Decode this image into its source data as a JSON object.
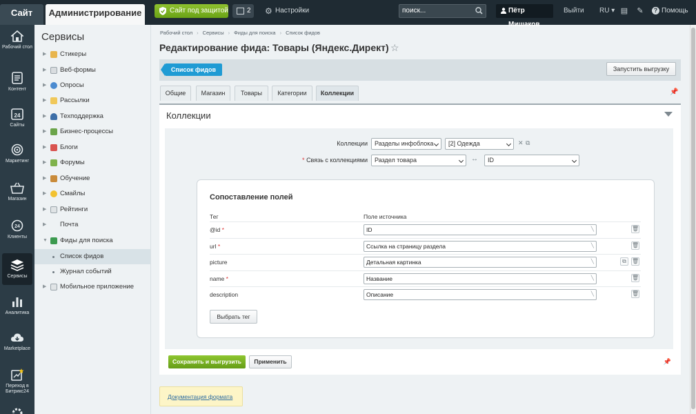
{
  "topbar": {
    "site": "Сайт",
    "admin": "Администрирование",
    "secure": "Сайт под защитой",
    "notif_count": "2",
    "settings": "Настройки",
    "search_placeholder": "поиск...",
    "user": "Пётр Мишаков",
    "logout": "Выйти",
    "lang": "RU",
    "help": "Помощь"
  },
  "leftnav": [
    {
      "label": "Рабочий стол",
      "icon": "home-icon"
    },
    {
      "label": "Контент",
      "icon": "document-icon"
    },
    {
      "label": "Сайты",
      "icon": "calendar-24-icon"
    },
    {
      "label": "Маркетинг",
      "icon": "target-icon"
    },
    {
      "label": "Магазин",
      "icon": "basket-icon"
    },
    {
      "label": "Клиенты",
      "icon": "clients-icon"
    },
    {
      "label": "Сервисы",
      "icon": "layers-icon"
    },
    {
      "label": "Аналитика",
      "icon": "bar-chart-icon"
    },
    {
      "label": "Marketplace",
      "icon": "cloud-download-icon"
    },
    {
      "label": "Переход в Битрикс24",
      "icon": "bitrix24-icon"
    }
  ],
  "panel": {
    "title": "Сервисы",
    "items": [
      "Стикеры",
      "Веб-формы",
      "Опросы",
      "Рассылки",
      "Техподдержка",
      "Бизнес-процессы",
      "Блоги",
      "Форумы",
      "Обучение",
      "Смайлы",
      "Рейтинги",
      "Почта",
      "Фиды для поиска"
    ],
    "subitems": [
      "Список фидов",
      "Журнал событий"
    ],
    "last": "Мобильное приложение"
  },
  "breadcrumb": [
    "Рабочий стол",
    "Сервисы",
    "Фиды для поиска",
    "Список фидов"
  ],
  "page_title": "Редактирование фида: Товары (Яндекс.Директ)",
  "toolbar": {
    "feed_list": "Список фидов",
    "run_export": "Запустить выгрузку"
  },
  "tabs": [
    "Общие",
    "Магазин",
    "Товары",
    "Категории",
    "Коллекции"
  ],
  "section_title": "Коллекции",
  "collections": {
    "label": "Коллекции",
    "source": "Разделы инфоблока",
    "value": "[2] Одежда",
    "link_label": "Связь с коллекциями",
    "link_left": "Раздел товара",
    "link_right": "ID"
  },
  "mapping": {
    "title": "Сопоставление полей",
    "col_tag": "Тег",
    "col_source": "Поле источника",
    "rows": [
      {
        "tag": "@id",
        "required": "*",
        "field": "ID"
      },
      {
        "tag": "url",
        "required": "*",
        "field": "Ссылка на страницу раздела"
      },
      {
        "tag": "picture",
        "required": "",
        "field": "Детальная картинка"
      },
      {
        "tag": "name",
        "required": "*",
        "field": "Название"
      },
      {
        "tag": "description",
        "required": "",
        "field": "Описание"
      }
    ],
    "select_tag": "Выбрать тег"
  },
  "actions": {
    "save_export": "Сохранить и выгрузить",
    "apply": "Применить"
  },
  "doc_link": "Документация формата"
}
